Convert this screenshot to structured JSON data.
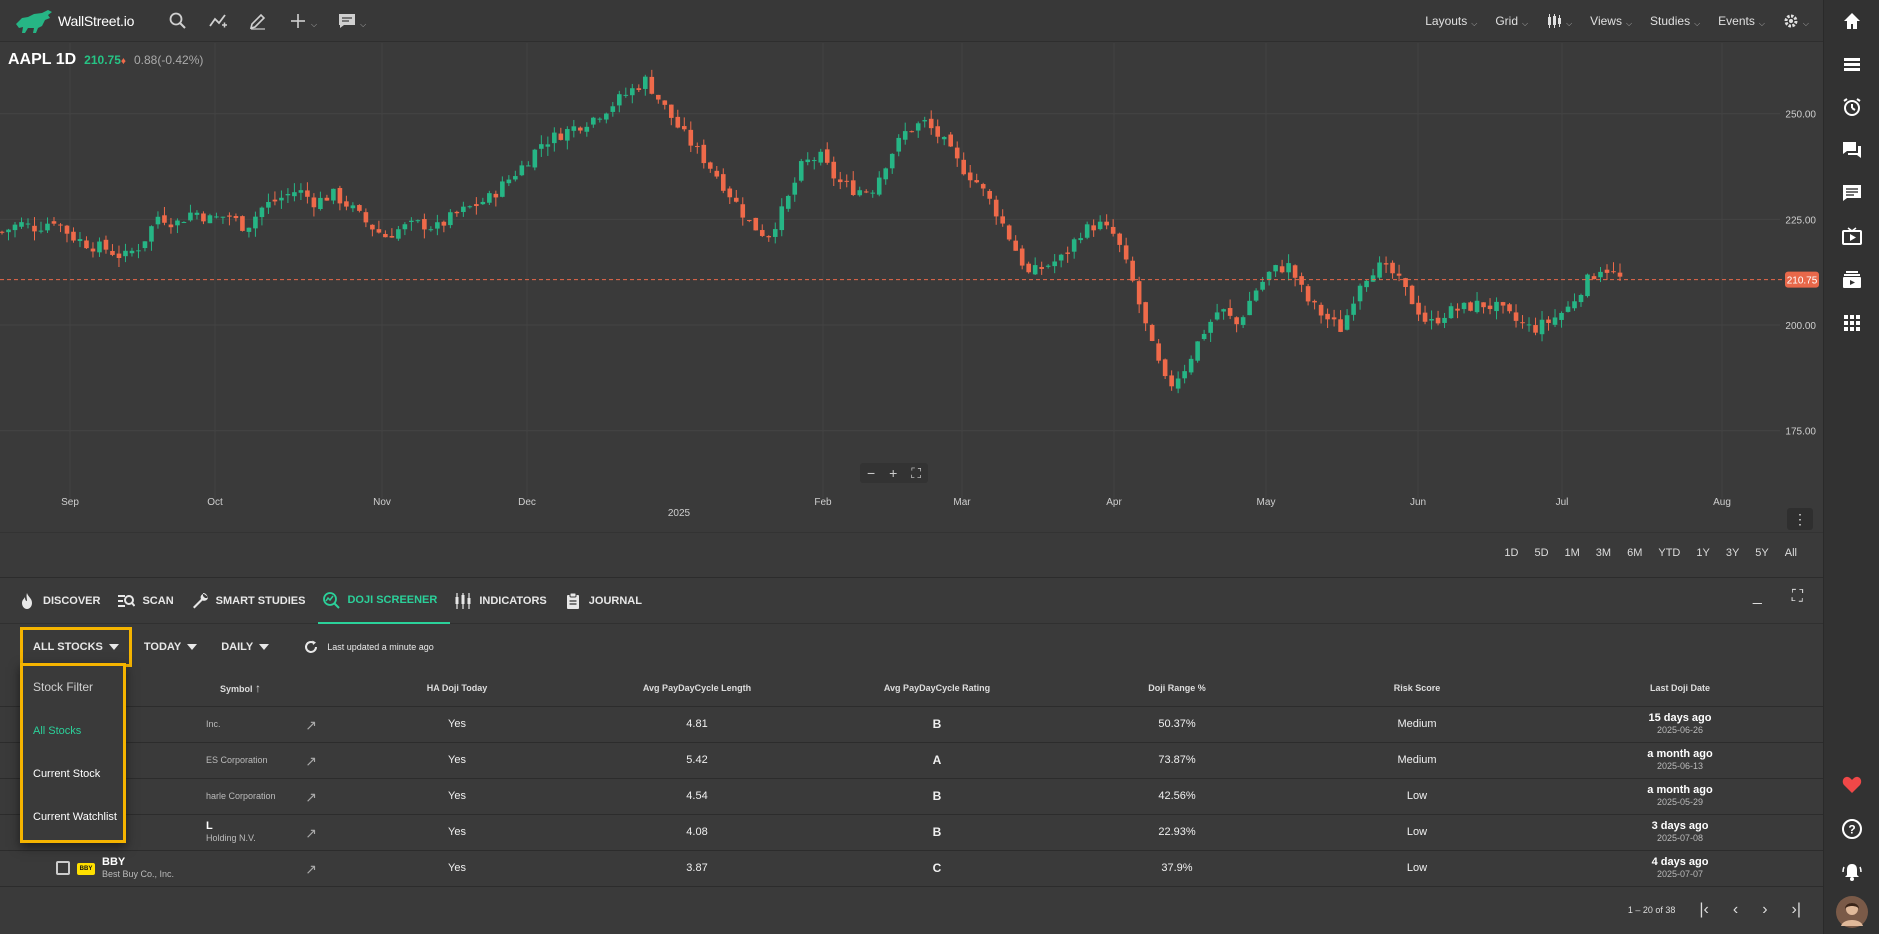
{
  "app": {
    "name": "WallStreet.io"
  },
  "toolbar": {
    "menus": [
      {
        "label": "Layouts"
      },
      {
        "label": "Grid"
      },
      {
        "label": "Views"
      },
      {
        "label": "Studies"
      },
      {
        "label": "Events"
      }
    ]
  },
  "chart": {
    "symbol": "AAPL",
    "interval": "1D",
    "price": "210.75",
    "change": "0.88(-0.42%)",
    "last_price_tag": "210.75",
    "y_ticks": [
      "250.00",
      "225.00",
      "200.00",
      "175.00"
    ],
    "x_ticks": [
      "Sep",
      "Oct",
      "Nov",
      "Dec",
      "Feb",
      "Mar",
      "Apr",
      "May",
      "Jun",
      "Jul",
      "Aug"
    ],
    "year_label": "2025",
    "zoom": {
      "minus": "−",
      "plus": "+"
    },
    "colors": {
      "up": "#26b585",
      "down": "#ef6a4a",
      "last_line": "#e8684a"
    },
    "close_path": [
      222,
      224,
      223,
      225,
      221,
      219,
      218,
      216,
      219,
      226,
      224,
      227,
      225,
      226,
      223,
      228,
      230,
      232,
      229,
      231,
      228,
      224,
      221,
      223,
      224,
      223,
      226,
      228,
      230,
      234,
      238,
      243,
      245,
      247,
      249,
      252,
      255,
      258,
      252,
      246,
      241,
      236,
      230,
      224,
      221,
      228,
      238,
      240,
      234,
      232,
      232,
      240,
      246,
      248,
      244,
      238,
      234,
      228,
      220,
      212,
      214,
      216,
      222,
      224,
      221,
      210,
      196,
      185,
      190,
      198,
      204,
      200,
      208,
      213,
      214,
      206,
      202,
      199,
      210,
      214,
      212,
      206,
      200,
      203,
      204,
      205,
      204,
      201,
      199,
      201,
      204,
      210,
      214,
      211
    ]
  },
  "ranges": [
    "1D",
    "5D",
    "1M",
    "3M",
    "6M",
    "YTD",
    "1Y",
    "3Y",
    "5Y",
    "All"
  ],
  "tabs": [
    {
      "label": "DISCOVER"
    },
    {
      "label": "SCAN"
    },
    {
      "label": "SMART STUDIES"
    },
    {
      "label": "DOJI SCREENER"
    },
    {
      "label": "INDICATORS"
    },
    {
      "label": "JOURNAL"
    }
  ],
  "filters": {
    "stock_filter": "ALL STOCKS",
    "period": "TODAY",
    "frequency": "DAILY",
    "updated": "Last updated a minute ago"
  },
  "table": {
    "columns": [
      "Symbol",
      "HA Doji Today",
      "Avg PayDayCycle Length",
      "Avg PayDayCycle Rating",
      "Doji Range %",
      "Risk Score",
      "Last Doji Date"
    ],
    "rows": [
      {
        "symbol": "",
        "name": "Inc.",
        "ha_doji": "Yes",
        "length": "4.81",
        "rating": "B",
        "range": "50.37%",
        "risk": "Medium",
        "ago": "15 days ago",
        "date": "2025-06-26"
      },
      {
        "symbol": "",
        "name": "ES Corporation",
        "ha_doji": "Yes",
        "length": "5.42",
        "rating": "A",
        "range": "73.87%",
        "risk": "Medium",
        "ago": "a month ago",
        "date": "2025-06-13"
      },
      {
        "symbol": "",
        "name": "harle Corporation",
        "ha_doji": "Yes",
        "length": "4.54",
        "rating": "B",
        "range": "42.56%",
        "risk": "Low",
        "ago": "a month ago",
        "date": "2025-05-29"
      },
      {
        "symbol": "L",
        "name": "Holding N.V.",
        "ha_doji": "Yes",
        "length": "4.08",
        "rating": "B",
        "range": "22.93%",
        "risk": "Low",
        "ago": "3 days ago",
        "date": "2025-07-08"
      },
      {
        "symbol": "BBY",
        "name": "Best Buy Co., Inc.",
        "ha_doji": "Yes",
        "length": "3.87",
        "rating": "C",
        "range": "37.9%",
        "risk": "Low",
        "ago": "4 days ago",
        "date": "2025-07-07"
      }
    ]
  },
  "dropdown": {
    "header": "Stock Filter",
    "items": [
      "All Stocks",
      "Current Stock",
      "Current Watchlist"
    ],
    "selected": "All Stocks"
  },
  "pager": {
    "info": "1 – 20 of 38"
  },
  "bby_logo_text": "BBY"
}
